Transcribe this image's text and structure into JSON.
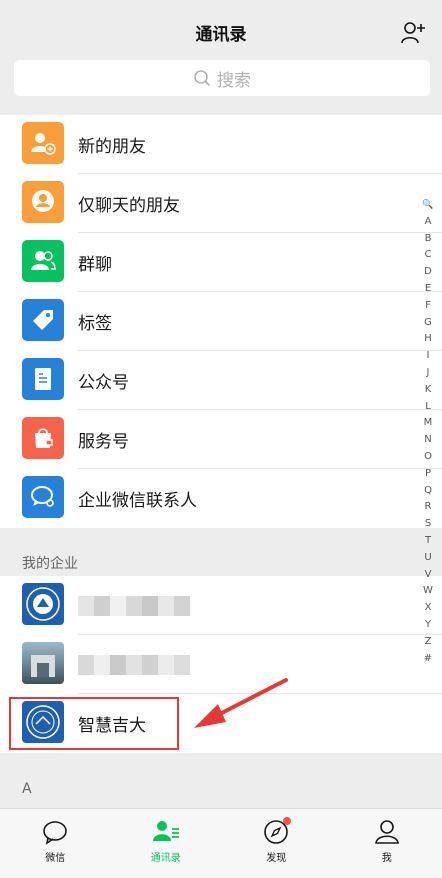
{
  "header": {
    "title": "通讯录",
    "add_icon": "add-contact-icon"
  },
  "search": {
    "placeholder": "搜索"
  },
  "menu": [
    {
      "label": "新的朋友",
      "icon": "new-friend-icon",
      "color": "#fa9d3b"
    },
    {
      "label": "仅聊天的朋友",
      "icon": "chat-only-friend-icon",
      "color": "#fa9d3b"
    },
    {
      "label": "群聊",
      "icon": "group-chat-icon",
      "color": "#07c160"
    },
    {
      "label": "标签",
      "icon": "tag-icon",
      "color": "#2782d7"
    },
    {
      "label": "公众号",
      "icon": "official-account-icon",
      "color": "#2782d7"
    },
    {
      "label": "服务号",
      "icon": "service-account-icon",
      "color": "#f5634a"
    },
    {
      "label": "企业微信联系人",
      "icon": "wecom-contact-icon",
      "color": "#2782d7"
    }
  ],
  "enterprise": {
    "section_title": "我的企业",
    "items": [
      {
        "label": "",
        "blurred": true
      },
      {
        "label": "",
        "blurred": true
      },
      {
        "label": "智慧吉大",
        "blurred": false
      }
    ]
  },
  "contacts_section": {
    "letter": "A"
  },
  "index_bar": [
    "🔍",
    "A",
    "B",
    "C",
    "D",
    "E",
    "F",
    "G",
    "H",
    "I",
    "J",
    "K",
    "L",
    "M",
    "N",
    "O",
    "P",
    "Q",
    "R",
    "S",
    "T",
    "U",
    "V",
    "W",
    "X",
    "Y",
    "Z",
    "#"
  ],
  "tabbar": [
    {
      "label": "微信",
      "icon": "chat-bubble-icon",
      "active": false
    },
    {
      "label": "通讯录",
      "icon": "contacts-icon",
      "active": true
    },
    {
      "label": "发现",
      "icon": "compass-icon",
      "active": false,
      "badge": true
    },
    {
      "label": "我",
      "icon": "person-icon",
      "active": false
    }
  ],
  "colors": {
    "accent": "#07c160",
    "highlight_box": "#e53935",
    "badge": "#fa5151"
  }
}
